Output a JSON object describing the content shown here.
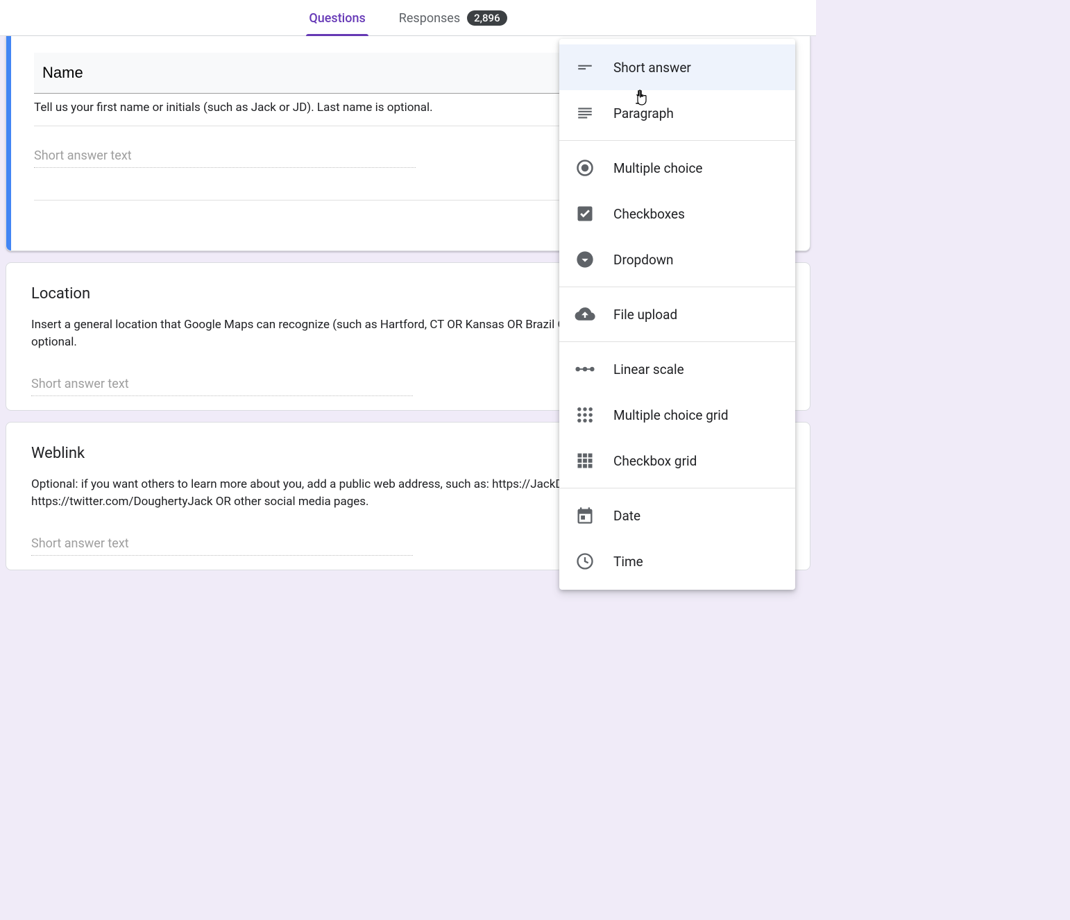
{
  "header": {
    "tabs": {
      "questions": "Questions",
      "responses": "Responses",
      "responses_count": "2,896"
    }
  },
  "questions": [
    {
      "title": "Name",
      "description": "Tell us your first name or initials (such as Jack or JD). Last name is optional.",
      "answer_placeholder": "Short answer text"
    },
    {
      "title": "Location",
      "description": "Insert a general location that Google Maps can recognize (such as Hartford, CT  OR   Kansas  OR   Brazil  OR   South Africa). Street address is optional.",
      "answer_placeholder": "Short answer text"
    },
    {
      "title": "Weblink",
      "description": "Optional: if you want others to learn more about you, add a public web address, such as: https://JackDougherty.org  OR   https://twitter.com/DoughertyJack  OR  other social media pages.",
      "answer_placeholder": "Short answer text"
    }
  ],
  "menu": {
    "items": [
      {
        "label": "Short answer"
      },
      {
        "label": "Paragraph"
      },
      {
        "label": "Multiple choice"
      },
      {
        "label": "Checkboxes"
      },
      {
        "label": "Dropdown"
      },
      {
        "label": "File upload"
      },
      {
        "label": "Linear scale"
      },
      {
        "label": "Multiple choice grid"
      },
      {
        "label": "Checkbox grid"
      },
      {
        "label": "Date"
      },
      {
        "label": "Time"
      }
    ]
  }
}
